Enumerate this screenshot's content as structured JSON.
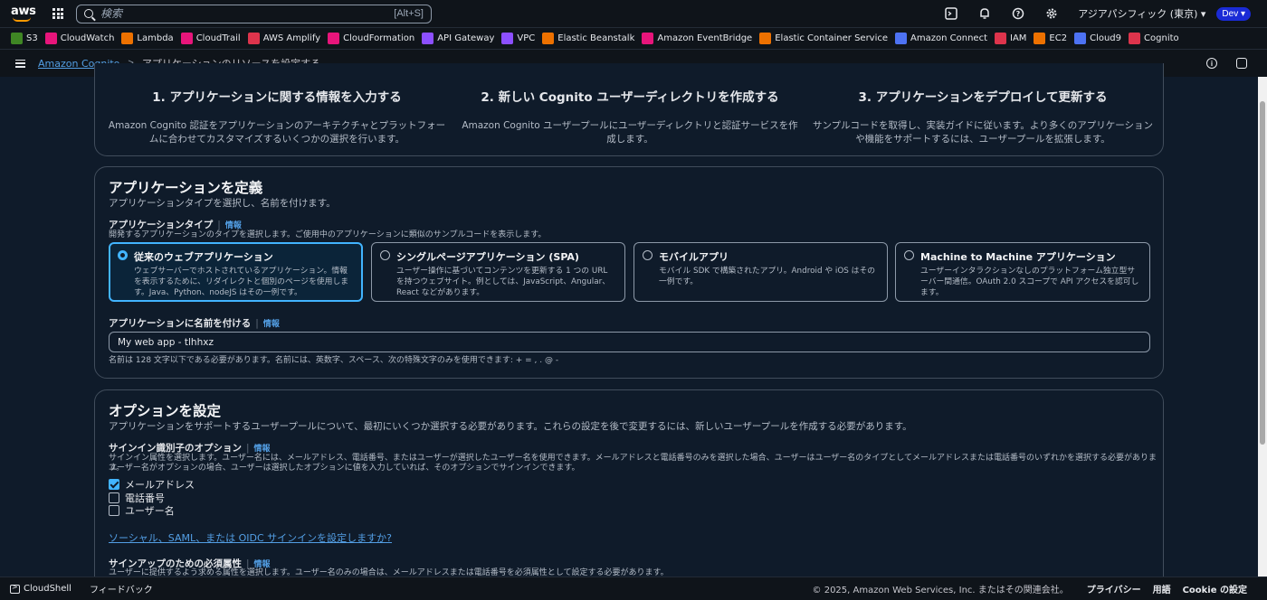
{
  "topnav": {
    "logo_text": "aws",
    "search": {
      "placeholder": "検索",
      "shortcut": "[Alt+S]"
    },
    "region": "アジアパシフィック (東京) ▾",
    "account": "Dev ▾"
  },
  "favorites": [
    {
      "label": "S3",
      "color": "#3f8624",
      "icon": "s3-icon"
    },
    {
      "label": "CloudWatch",
      "color": "#e7157b",
      "icon": "cloudwatch-icon"
    },
    {
      "label": "Lambda",
      "color": "#ed7100",
      "icon": "lambda-icon"
    },
    {
      "label": "CloudTrail",
      "color": "#e7157b",
      "icon": "cloudtrail-icon"
    },
    {
      "label": "AWS Amplify",
      "color": "#dd344c",
      "icon": "amplify-icon"
    },
    {
      "label": "CloudFormation",
      "color": "#e7157b",
      "icon": "cloudformation-icon"
    },
    {
      "label": "API Gateway",
      "color": "#8c4fff",
      "icon": "api-gateway-icon"
    },
    {
      "label": "VPC",
      "color": "#8c4fff",
      "icon": "vpc-icon"
    },
    {
      "label": "Elastic Beanstalk",
      "color": "#ed7100",
      "icon": "beanstalk-icon"
    },
    {
      "label": "Amazon EventBridge",
      "color": "#e7157b",
      "icon": "eventbridge-icon"
    },
    {
      "label": "Elastic Container Service",
      "color": "#ed7100",
      "icon": "ecs-icon"
    },
    {
      "label": "Amazon Connect",
      "color": "#4d72f3",
      "icon": "connect-icon"
    },
    {
      "label": "IAM",
      "color": "#dd344c",
      "icon": "iam-icon"
    },
    {
      "label": "EC2",
      "color": "#ed7100",
      "icon": "ec2-icon"
    },
    {
      "label": "Cloud9",
      "color": "#4d72f3",
      "icon": "cloud9-icon"
    },
    {
      "label": "Cognito",
      "color": "#dd344c",
      "icon": "cognito-icon"
    }
  ],
  "breadcrumb": {
    "root": "Amazon Cognito",
    "separator": ">",
    "current": "アプリケーションのリソースを設定する"
  },
  "steps": [
    {
      "title": "1. アプリケーションに関する情報を入力する",
      "desc": "Amazon Cognito 認証をアプリケーションのアーキテクチャとプラットフォームに合わせてカスタマイズするいくつかの選択を行います。"
    },
    {
      "title": "2. 新しい Cognito ユーザーディレクトリを作成する",
      "desc": "Amazon Cognito ユーザープールにユーザーディレクトリと認証サービスを作成します。"
    },
    {
      "title": "3. アプリケーションをデプロイして更新する",
      "desc": "サンプルコードを取得し、実装ガイドに従います。より多くのアプリケーションや機能をサポートするには、ユーザープールを拡張します。"
    }
  ],
  "define": {
    "title": "アプリケーションを定義",
    "desc": "アプリケーションタイプを選択し、名前を付けます。",
    "type_label": "アプリケーションタイプ",
    "info": "情報",
    "type_hint": "開発するアプリケーションのタイプを選択します。ご使用中のアプリケーションに類似のサンプルコードを表示します。",
    "tiles": [
      {
        "title": "従来のウェブアプリケーション",
        "desc": "ウェブサーバーでホストされているアプリケーション。情報を表示するために、リダイレクトと個別のページを使用します。Java、Python、nodeJS はその一例です。",
        "selected": true
      },
      {
        "title": "シングルページアプリケーション (SPA)",
        "desc": "ユーザー操作に基づいてコンテンツを更新する 1 つの URL を持つウェブサイト。例としては、JavaScript、Angular、React などがあります。",
        "selected": false
      },
      {
        "title": "モバイルアプリ",
        "desc": "モバイル SDK で構築されたアプリ。Android や iOS はその一例です。",
        "selected": false
      },
      {
        "title": "Machine to Machine アプリケーション",
        "desc": "ユーザーインタラクションなしのプラットフォーム独立型サーバー間通信。OAuth 2.0 スコープで API アクセスを認可します。",
        "selected": false
      }
    ],
    "name_label": "アプリケーションに名前を付ける",
    "name_value": "My web app - tlhhxz",
    "name_hint": "名前は 128 文字以下である必要があります。名前には、英数字、スペース、次の特殊文字のみを使用できます: + = , . @ -"
  },
  "options": {
    "title": "オプションを設定",
    "desc": "アプリケーションをサポートするユーザープールについて、最初にいくつか選択する必要があります。これらの設定を後で変更するには、新しいユーザープールを作成する必要があります。",
    "signin_label": "サインイン識別子のオプション",
    "info": "情報",
    "signin_hint_1": "サインイン属性を選択します。ユーザー名には、メールアドレス、電話番号、またはユーザーが選択したユーザー名を使用できます。メールアドレスと電話番号のみを選択した場合、ユーザーはユーザー名のタイプとしてメールアドレスまたは電話番号のいずれかを選択する必要があります。",
    "signin_hint_2": "ユーザー名がオプションの場合、ユーザーは選択したオプションに値を入力していれば、そのオプションでサインインできます。",
    "checkboxes": [
      {
        "label": "メールアドレス",
        "checked": true
      },
      {
        "label": "電話番号",
        "checked": false
      },
      {
        "label": "ユーザー名",
        "checked": false
      }
    ],
    "social_link": "ソーシャル、SAML、または OIDC サインインを設定しますか?",
    "signup_label": "サインアップのための必須属性",
    "signup_hint": "ユーザーに提供するよう求める属性を選択します。ユーザー名のみの場合は、メールアドレスまたは電話番号を必須属性として設定する必要があります。"
  },
  "footer": {
    "cloudshell": "CloudShell",
    "feedback": "フィードバック",
    "copyright": "© 2025, Amazon Web Services, Inc. またはその関連会社。",
    "privacy": "プライバシー",
    "terms": "用語",
    "cookie": "Cookie の設定"
  }
}
